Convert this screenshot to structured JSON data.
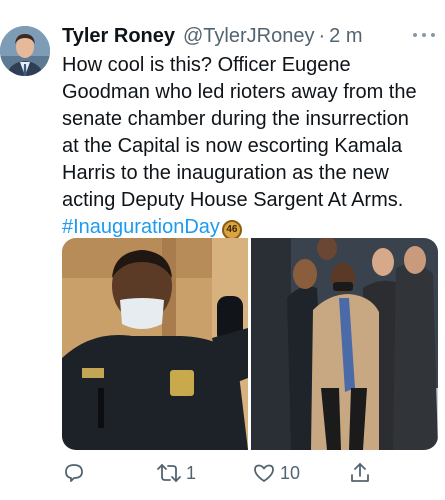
{
  "tweet": {
    "author_name": "Tyler Roney",
    "handle": "@TylerJRoney",
    "separator": "·",
    "time": "2 m",
    "text_lines": [
      "How cool is this? Officer Eugene",
      "Goodman who led rioters away from the",
      "senate chamber during the insurrection",
      "at the Capital is now escorting Kamala",
      "Harris to the inauguration as the new",
      "acting Deputy House Sargent At Arms."
    ],
    "hashtag": "#InaugurationDay",
    "hashtag_emoji": "46"
  },
  "actions": {
    "reply_count": "",
    "retweet_count": "1",
    "like_count": "10"
  },
  "icons": {
    "more": "more-horizontal-icon",
    "reply": "reply-icon",
    "retweet": "retweet-icon",
    "like": "heart-icon",
    "share": "share-icon"
  },
  "colors": {
    "link": "#1d9bf0",
    "muted": "#536471"
  }
}
